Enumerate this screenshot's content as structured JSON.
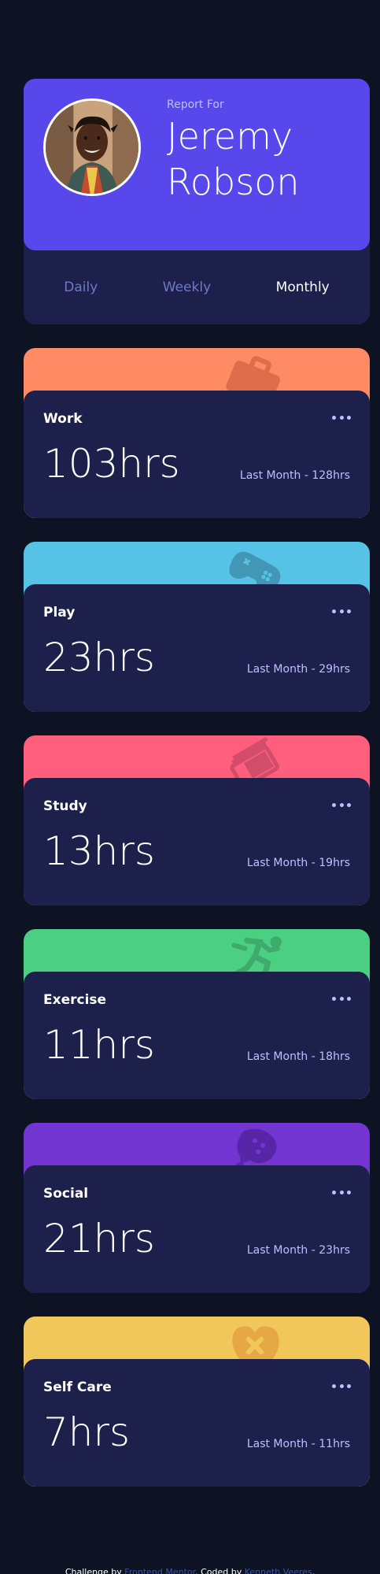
{
  "profile": {
    "report_for": "Report For",
    "name": "Jeremy Robson"
  },
  "timeframes": [
    {
      "label": "Daily",
      "active": false
    },
    {
      "label": "Weekly",
      "active": false
    },
    {
      "label": "Monthly",
      "active": true
    }
  ],
  "activities": [
    {
      "title": "Work",
      "current": "103hrs",
      "previous": "Last Month - 128hrs",
      "color": "#ff8b64",
      "icon": "briefcase-icon"
    },
    {
      "title": "Play",
      "current": "23hrs",
      "previous": "Last Month - 29hrs",
      "color": "#55c2e6",
      "icon": "gamepad-icon"
    },
    {
      "title": "Study",
      "current": "13hrs",
      "previous": "Last Month - 19hrs",
      "color": "#ff5e7d",
      "icon": "books-icon"
    },
    {
      "title": "Exercise",
      "current": "11hrs",
      "previous": "Last Month - 18hrs",
      "color": "#4bcf82",
      "icon": "running-person-icon"
    },
    {
      "title": "Social",
      "current": "21hrs",
      "previous": "Last Month - 23hrs",
      "color": "#7335d2",
      "icon": "chat-bubble-icon"
    },
    {
      "title": "Self Care",
      "current": "7hrs",
      "previous": "Last Month - 11hrs",
      "color": "#f1c75b",
      "icon": "heart-bandage-icon"
    }
  ],
  "footer": {
    "challenge_by": "Challenge by",
    "challenge_link": "Frontend Mentor",
    "coded_by": "Coded by",
    "author_link": "Kenneth Veeres"
  }
}
